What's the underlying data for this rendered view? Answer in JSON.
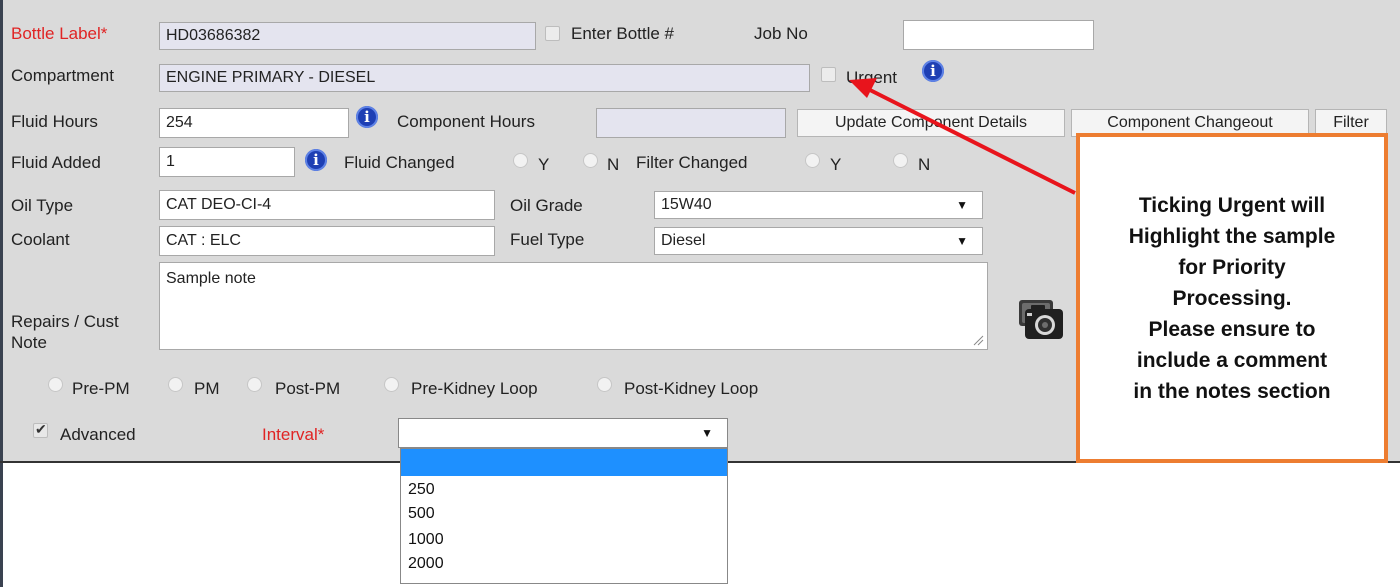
{
  "form": {
    "bottle_label": {
      "label": "Bottle Label*",
      "value": "HD03686382"
    },
    "enter_bottle": {
      "label": "Enter Bottle #"
    },
    "job_no": {
      "label": "Job No",
      "value": ""
    },
    "compartment": {
      "label": "Compartment",
      "value": "ENGINE PRIMARY - DIESEL"
    },
    "urgent": {
      "label": "Urgent"
    },
    "fluid_hours": {
      "label": "Fluid Hours",
      "value": "254"
    },
    "component_hours": {
      "label": "Component Hours",
      "value": ""
    },
    "buttons": {
      "update_component_details": "Update Component Details",
      "component_changeout": "Component Changeout",
      "filter": "Filter"
    },
    "fluid_added": {
      "label": "Fluid Added",
      "value": "1"
    },
    "fluid_changed": {
      "label": "Fluid Changed",
      "y": "Y",
      "n": "N"
    },
    "filter_changed": {
      "label": "Filter Changed",
      "y": "Y",
      "n": "N"
    },
    "oil_type": {
      "label": "Oil Type",
      "value": "CAT DEO-CI-4"
    },
    "oil_grade": {
      "label": "Oil Grade",
      "value": "15W40"
    },
    "coolant": {
      "label": "Coolant",
      "value": "CAT : ELC"
    },
    "fuel_type": {
      "label": "Fuel Type",
      "value": "Diesel"
    },
    "repairs_note": {
      "label_line1": "Repairs / Cust",
      "label_line2": "Note",
      "value": "Sample note"
    },
    "pm_options": [
      "Pre-PM",
      "PM",
      "Post-PM",
      "Pre-Kidney Loop",
      "Post-Kidney Loop"
    ],
    "advanced": {
      "label": "Advanced",
      "checked": true
    },
    "interval": {
      "label": "Interval*",
      "value": "",
      "options": [
        "",
        "250",
        "500",
        "1000",
        "2000"
      ]
    }
  },
  "annotation": {
    "lines": [
      "Ticking Urgent will",
      "Highlight the sample",
      "for Priority",
      "Processing.",
      "Please  ensure to",
      "include a comment",
      "in the notes section"
    ]
  },
  "icons": {
    "info": "info-icon",
    "camera": "camera-icon",
    "caret": "▼"
  },
  "colors": {
    "required_label": "#e02424",
    "callout_border": "#ed7d31",
    "arrow": "#e8141c",
    "dropdown_highlight": "#1e90ff",
    "info_icon": "#1e3fb4"
  }
}
